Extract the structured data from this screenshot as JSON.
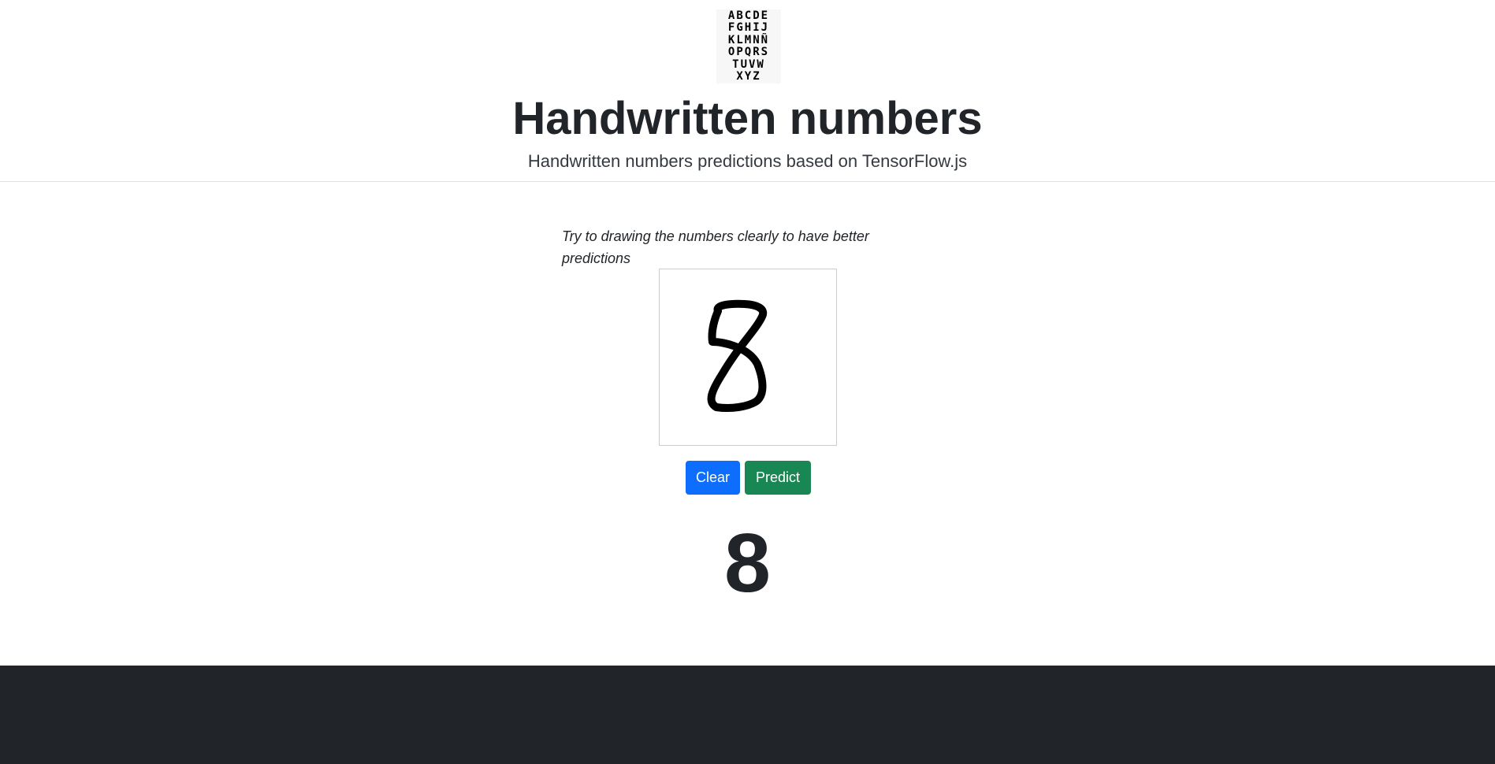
{
  "header": {
    "logo_lines": [
      "ABCDE",
      "FGHIJ",
      "KLMNÑ",
      "OPQRS",
      "TUVW",
      "XYZ"
    ],
    "title": "Handwritten numbers",
    "subtitle": "Handwritten numbers predictions based on TensorFlow.js"
  },
  "main": {
    "hint": "Try to drawing the numbers clearly to have better predictions",
    "canvas": {
      "drawn_digit_icon": "handwritten-eight-stroke"
    },
    "buttons": {
      "clear_label": "Clear",
      "predict_label": "Predict"
    },
    "prediction": "8"
  },
  "colors": {
    "clear_button": "#0d6efd",
    "predict_button": "#198754",
    "footer": "#212529",
    "text": "#212529"
  }
}
